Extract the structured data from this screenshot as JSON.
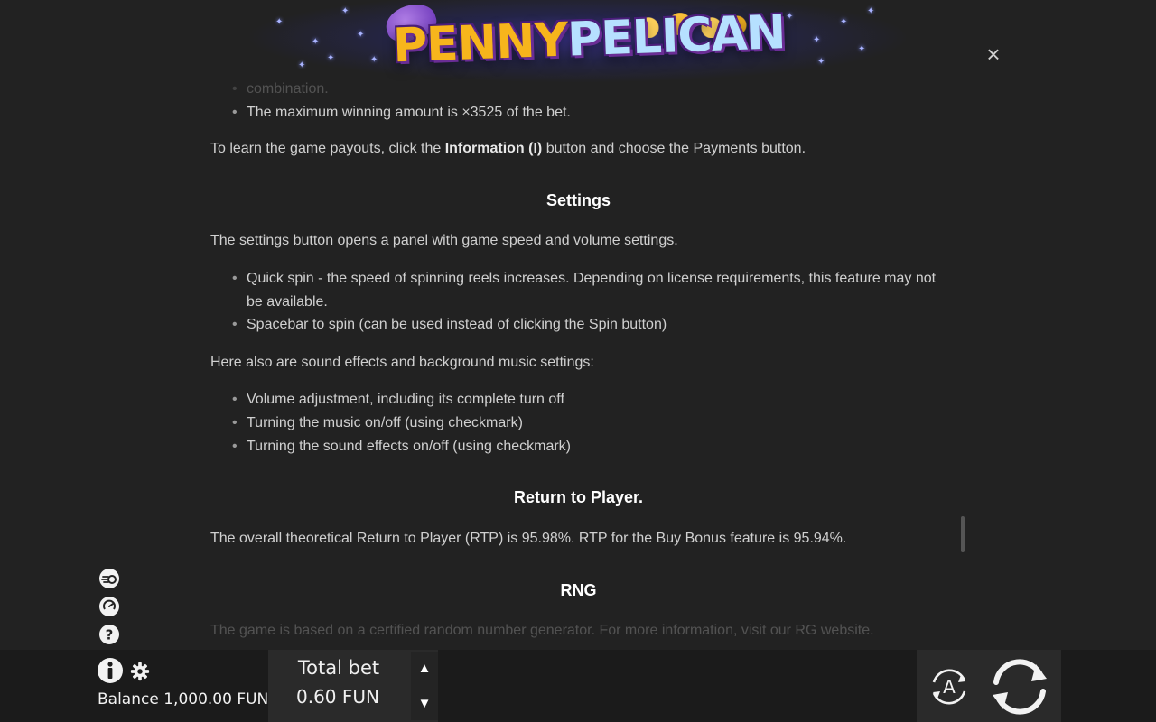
{
  "header": {
    "logo_word_1": "PENNY",
    "logo_word_2": "PELICAN",
    "close_symbol": "×"
  },
  "rules": {
    "faded_top_line": "combination.",
    "max_win_item": "The maximum winning amount is ×3525 of the bet.",
    "payouts_before": "To learn the game payouts, click the ",
    "payouts_bold": "Information (I)",
    "payouts_after": " button and choose the Payments button.",
    "settings_heading": "Settings",
    "settings_intro": "The settings button opens a panel with game speed and volume settings.",
    "settings_items": [
      "Quick spin - the speed of spinning reels increases. Depending on license requirements, this feature may not be available.",
      "Spacebar to spin (can be used instead of clicking the Spin button)"
    ],
    "sound_intro": "Here also are sound effects and background music settings:",
    "sound_items": [
      "Volume adjustment, including its complete turn off",
      "Turning the music on/off (using checkmark)",
      "Turning the sound effects on/off (using checkmark)"
    ],
    "rtp_heading": "Return to Player.",
    "rtp_text": "The overall theoretical Return to Player (RTP) is 95.98%. RTP for the Buy Bonus feature is 95.94%.",
    "rng_heading": "RNG",
    "rng_faded_text": "The game is based on a certified random number generator. For more information, visit our RG website."
  },
  "side_icons": [
    "quick-spin-icon",
    "turbo-icon",
    "help-icon"
  ],
  "bottom_bar": {
    "balance_label": "Balance",
    "balance_value": "1,000.00 FUN",
    "total_bet_label": "Total bet",
    "total_bet_value": "0.60 FUN",
    "bet_up_symbol": "▲",
    "bet_down_symbol": "▼",
    "autoplay_letter": "A"
  },
  "colors": {
    "background": "#222222",
    "bottom_bar": "#1b1b1b",
    "panel": "#2a2a2a",
    "text": "#d0d0d0",
    "heading": "#ffffff",
    "logo_gold": "#f7b51c",
    "logo_blue": "#b6e0ff",
    "logo_purple": "#6a2d95"
  }
}
